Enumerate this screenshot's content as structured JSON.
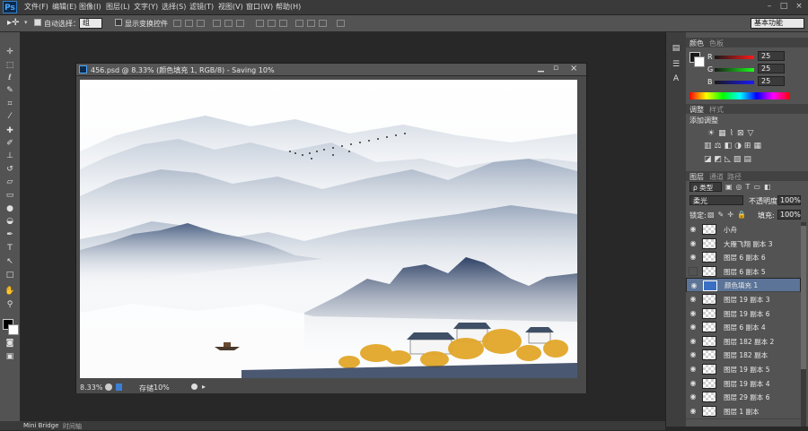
{
  "app": {
    "logo": "Ps"
  },
  "menu": [
    "文件(F)",
    "编辑(E)",
    "图像(I)",
    "图层(L)",
    "文字(Y)",
    "选择(S)",
    "滤镜(T)",
    "视图(V)",
    "窗口(W)",
    "帮助(H)"
  ],
  "window_controls": [
    "–",
    "□",
    "×"
  ],
  "options": {
    "auto_select_label": "自动选择：",
    "auto_select_value": "组",
    "show_transform_label": "显示变换控件",
    "workspace": "基本功能"
  },
  "document": {
    "title": "456.psd @ 8.33% (颜色填充 1, RGB/8) - Saving 10%",
    "zoom": "8.33%",
    "status_label": "存储",
    "status_value": "10%"
  },
  "color_panel": {
    "tabs": [
      "颜色",
      "色板"
    ],
    "r_label": "R",
    "r_value": "25",
    "g_label": "G",
    "g_value": "25",
    "b_label": "B",
    "b_value": "25"
  },
  "adjust_panel": {
    "tabs": [
      "调整",
      "样式"
    ],
    "subtitle": "添加调整"
  },
  "layers_panel": {
    "tabs": [
      "图层",
      "通道",
      "路径"
    ],
    "kind": "ρ 类型",
    "blend_mode": "柔光",
    "opacity_label": "不透明度:",
    "opacity_value": "100%",
    "lock_label": "锁定:",
    "fill_label": "填充:",
    "fill_value": "100%",
    "layers": [
      {
        "name": "小舟",
        "visible": true,
        "selected": false,
        "thumb": "checker"
      },
      {
        "name": "大雁飞翔 副本 3",
        "visible": true,
        "selected": false,
        "thumb": "checker"
      },
      {
        "name": "图层 6 副本 6",
        "visible": true,
        "selected": false,
        "thumb": "checker"
      },
      {
        "name": "图层 6 副本 5",
        "visible": false,
        "selected": false,
        "thumb": "checker"
      },
      {
        "name": "颜色填充 1",
        "visible": true,
        "selected": true,
        "thumb": "fill"
      },
      {
        "name": "图层 19 副本 3",
        "visible": true,
        "selected": false,
        "thumb": "checker"
      },
      {
        "name": "图层 19 副本 6",
        "visible": true,
        "selected": false,
        "thumb": "checker"
      },
      {
        "name": "图层 6 副本 4",
        "visible": true,
        "selected": false,
        "thumb": "checker"
      },
      {
        "name": "图层 182 副本 2",
        "visible": true,
        "selected": false,
        "thumb": "checker"
      },
      {
        "name": "图层 182 副本",
        "visible": true,
        "selected": false,
        "thumb": "checker"
      },
      {
        "name": "图层 19 副本 5",
        "visible": true,
        "selected": false,
        "thumb": "checker"
      },
      {
        "name": "图层 19 副本 4",
        "visible": true,
        "selected": false,
        "thumb": "checker"
      },
      {
        "name": "图层 29 副本 6",
        "visible": true,
        "selected": false,
        "thumb": "checker"
      },
      {
        "name": "图层 1 副本",
        "visible": true,
        "selected": false,
        "thumb": "checker"
      }
    ]
  },
  "bottom_tabs": [
    "Mini Bridge",
    "时间轴"
  ]
}
